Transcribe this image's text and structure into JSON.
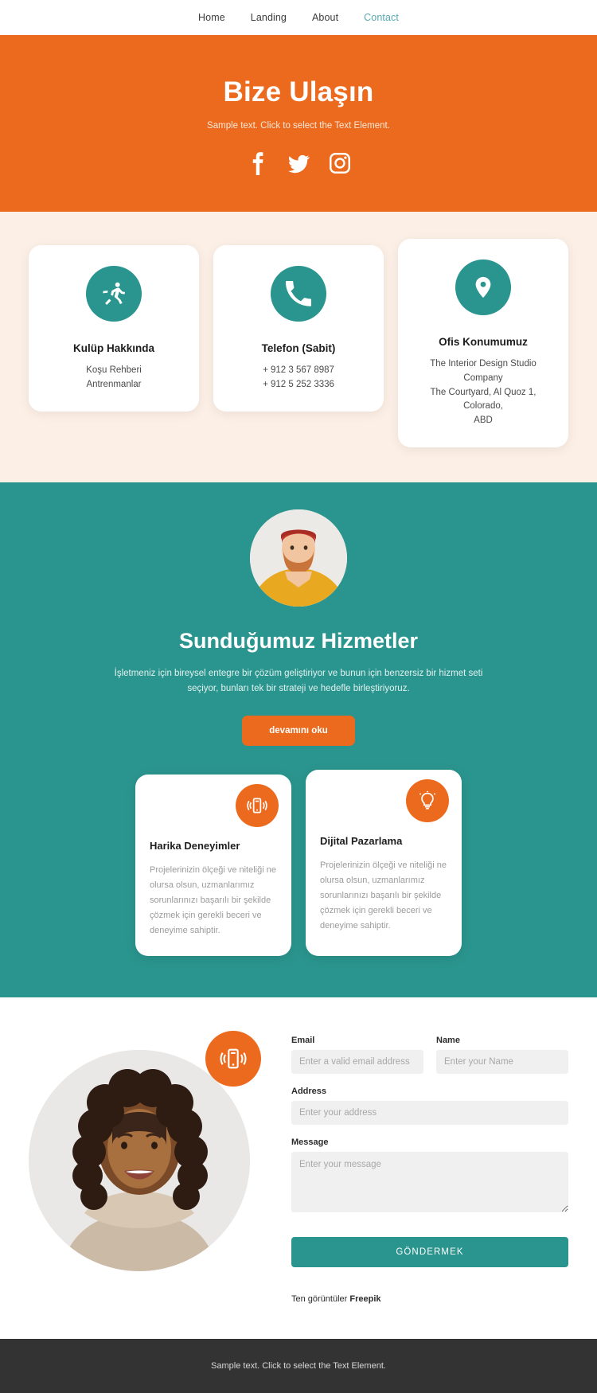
{
  "nav": {
    "items": [
      {
        "label": "Home",
        "active": false
      },
      {
        "label": "Landing",
        "active": false
      },
      {
        "label": "About",
        "active": false
      },
      {
        "label": "Contact",
        "active": true
      }
    ]
  },
  "hero": {
    "title": "Bize Ulaşın",
    "subtitle": "Sample text. Click to select the Text Element.",
    "socials": [
      {
        "name": "facebook-icon"
      },
      {
        "name": "twitter-icon"
      },
      {
        "name": "instagram-icon"
      }
    ],
    "bg_color": "#ec6a1e"
  },
  "info_cards": [
    {
      "icon": "running-icon",
      "title": "Kulüp Hakkında",
      "lines": [
        "Koşu Rehberi",
        "Antrenmanlar"
      ]
    },
    {
      "icon": "phone-icon",
      "title": "Telefon (Sabit)",
      "lines": [
        "+ 912 3 567 8987",
        "+ 912 5 252 3336"
      ]
    },
    {
      "icon": "location-pin-icon",
      "title": "Ofis Konumumuz",
      "lines": [
        "The Interior Design Studio Company",
        "The Courtyard, Al Quoz 1, Colorado,",
        "ABD"
      ]
    }
  ],
  "services": {
    "title": "Sunduğumuz Hizmetler",
    "text": "İşletmeniz için bireysel entegre bir çözüm geliştiriyor ve bunun için benzersiz bir hizmet seti seçiyor, bunları tek bir strateji ve hedefle birleştiriyoruz.",
    "button_label": "devamını oku",
    "bg_color": "#2a958e",
    "avatar": "bearded-man-avatar",
    "features": [
      {
        "icon": "mobile-vibrate-icon",
        "title": "Harika Deneyimler",
        "text": "Projelerinizin ölçeği ve niteliği ne olursa olsun, uzmanlarımız sorunlarınızı başarılı bir şekilde çözmek için gerekli beceri ve deneyime sahiptir."
      },
      {
        "icon": "lightbulb-icon",
        "title": "Dijital Pazarlama",
        "text": "Projelerinizin ölçeği ve niteliği ne olursa olsun, uzmanlarımız sorunlarınızı başarılı bir şekilde çözmek için gerekli beceri ve deneyime sahiptir."
      }
    ]
  },
  "contact": {
    "photo": "smiling-woman-photo",
    "photo_badge_icon": "mobile-vibrate-icon",
    "fields": {
      "email": {
        "label": "Email",
        "placeholder": "Enter a valid email address",
        "value": ""
      },
      "name": {
        "label": "Name",
        "placeholder": "Enter your Name",
        "value": ""
      },
      "address": {
        "label": "Address",
        "placeholder": "Enter your address",
        "value": ""
      },
      "message": {
        "label": "Message",
        "placeholder": "Enter your message",
        "value": ""
      }
    },
    "submit_label": "GÖNDERMEK",
    "credit_prefix": "Ten görüntüler ",
    "credit_brand": "Freepik"
  },
  "footer": {
    "text": "Sample text. Click to select the Text Element.",
    "bg_color": "#333333"
  }
}
